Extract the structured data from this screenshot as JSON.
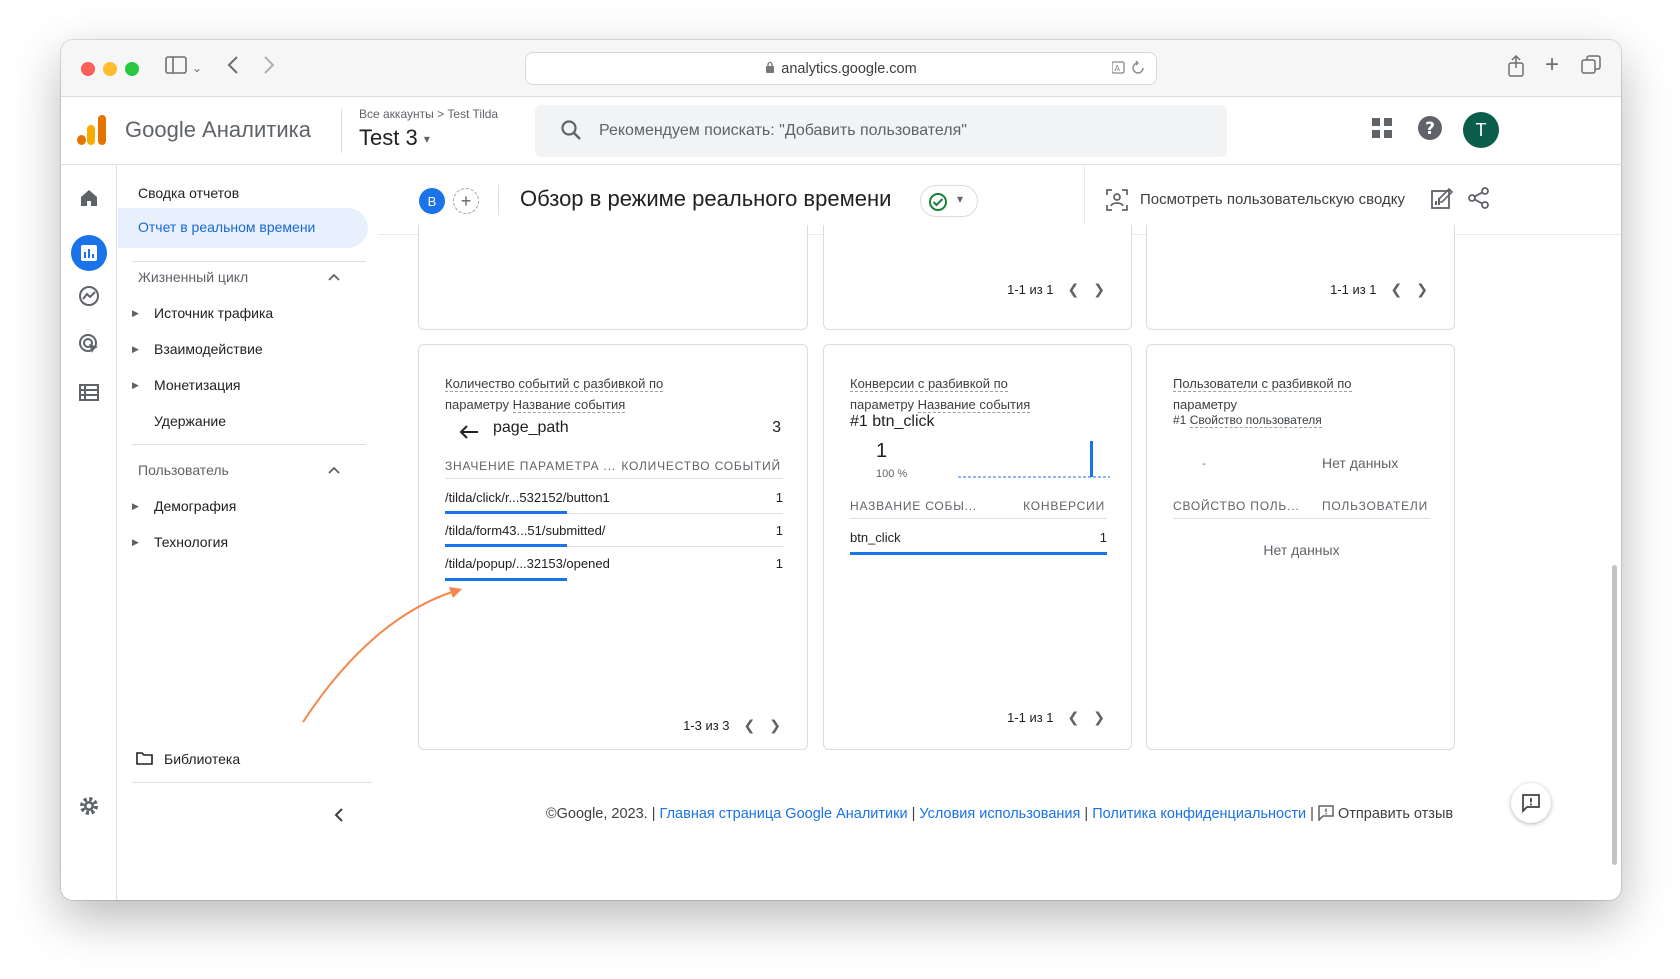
{
  "browser": {
    "url": "analytics.google.com"
  },
  "header": {
    "product": "Google Аналитика",
    "breadcrumb": "Все аккаунты > Test Tilda",
    "property": "Test 3",
    "search_placeholder": "Рекомендуем поискать: \"Добавить пользователя\"",
    "avatar_letter": "T"
  },
  "nav": {
    "summary": "Сводка отчетов",
    "active": "Отчет в реальном времени",
    "lifecycle": "Жизненный цикл",
    "lifecycle_items": [
      "Источник трафика",
      "Взаимодействие",
      "Монетизация",
      "Удержание"
    ],
    "user": "Пользователь",
    "user_items": [
      "Демография",
      "Технология"
    ],
    "library": "Библиотека"
  },
  "topbar": {
    "segment_letter": "B",
    "title": "Обзор в режиме реального времени",
    "user_snapshot": "Посмотреть пользовательскую сводку"
  },
  "cards_top": {
    "pager_mid": "1-1 из 1",
    "pager_right": "1-1 из 1"
  },
  "card_events": {
    "title_prefix": "Количество событий с разбивкой по",
    "title_param": "параметру",
    "title_dim": "Название события",
    "dimension": "page_path",
    "total": "3",
    "col1": "ЗНАЧЕНИЕ ПАРАМЕТРА ...",
    "col2": "КОЛИЧЕСТВО СОБЫТИЙ",
    "rows": [
      {
        "label": "/tilda/click/r...532152/button1",
        "value": "1"
      },
      {
        "label": "/tilda/form43...51/submitted/",
        "value": "1"
      },
      {
        "label": "/tilda/popup/...32153/opened",
        "value": "1"
      }
    ],
    "pager": "1-3 из 3"
  },
  "card_conversions": {
    "title_prefix": "Конверсии с разбивкой по",
    "title_param": "параметру",
    "title_dim": "Название события",
    "top_rank": "#1",
    "top_name": "btn_click",
    "big_value": "1",
    "percent": "100 %",
    "col1": "НАЗВАНИЕ СОБЫ...",
    "col2": "КОНВЕРСИИ",
    "rows": [
      {
        "label": "btn_click",
        "value": "1"
      }
    ],
    "pager": "1-1 из 1"
  },
  "card_users": {
    "title_prefix": "Пользователи с разбивкой по",
    "title_param": "параметру",
    "title_dim": "Свойство пользователя",
    "rank": "#1",
    "no_data_top": "Нет данных",
    "dash": "-",
    "col1": "СВОЙСТВО ПОЛЬ...",
    "col2": "ПОЛЬЗОВАТЕЛИ",
    "no_data": "Нет данных"
  },
  "footer": {
    "copyright": "©Google, 2023. |",
    "link_home": "Главная страница Google Аналитики",
    "sep1": "|",
    "link_terms": "Условия использования",
    "sep2": "|",
    "link_privacy": "Политика конфиденциальности",
    "sep3": "|",
    "feedback": "Отправить отзыв"
  },
  "colors": {
    "accent": "#1a73e8",
    "arrow": "#f4874b",
    "ga_orange": "#f9ab00",
    "ga_dark_orange": "#e37400"
  }
}
